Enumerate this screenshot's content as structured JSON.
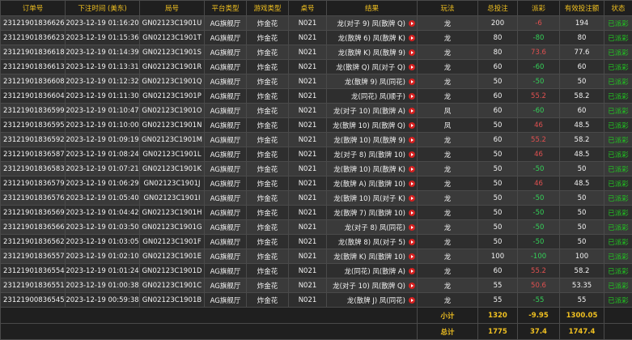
{
  "headers": [
    "订单号",
    "下注时间 (美东)",
    "局号",
    "平台类型",
    "游戏类型",
    "桌号",
    "结果",
    "玩法",
    "总投注",
    "派彩",
    "有效投注额",
    "状态"
  ],
  "rows": [
    {
      "id": "231219018366262",
      "time": "2023-12-19 01:16:20",
      "round": "GN02123C1901U",
      "platform": "AG旗舰厅",
      "game": "炸金花",
      "table": "N021",
      "result": "龙(对子 9) 凤(散牌 Q)",
      "play": "龙",
      "bet": "200",
      "payout": "-6",
      "payout_sign": "neg",
      "valid": "194",
      "status": "已派彩"
    },
    {
      "id": "231219018366230",
      "time": "2023-12-19 01:15:36",
      "round": "GN02123C1901T",
      "platform": "AG旗舰厅",
      "game": "炸金花",
      "table": "N021",
      "result": "龙(散牌 6) 凤(散牌 K)",
      "play": "龙",
      "bet": "80",
      "payout": "-80",
      "payout_sign": "pos",
      "valid": "80",
      "status": "已派彩"
    },
    {
      "id": "231219018366189",
      "time": "2023-12-19 01:14:39",
      "round": "GN02123C1901S",
      "platform": "AG旗舰厅",
      "game": "炸金花",
      "table": "N021",
      "result": "龙(散牌 K) 凤(散牌 9)",
      "play": "龙",
      "bet": "80",
      "payout": "73.6",
      "payout_sign": "neg",
      "valid": "77.6",
      "status": "已派彩"
    },
    {
      "id": "231219018366130",
      "time": "2023-12-19 01:13:31",
      "round": "GN02123C1901R",
      "platform": "AG旗舰厅",
      "game": "炸金花",
      "table": "N021",
      "result": "龙(散牌 Q) 凤(对子 Q)",
      "play": "龙",
      "bet": "60",
      "payout": "-60",
      "payout_sign": "pos",
      "valid": "60",
      "status": "已派彩"
    },
    {
      "id": "231219018366083",
      "time": "2023-12-19 01:12:32",
      "round": "GN02123C1901Q",
      "platform": "AG旗舰厅",
      "game": "炸金花",
      "table": "N021",
      "result": "龙(散牌 9) 凤(同花)",
      "play": "龙",
      "bet": "50",
      "payout": "-50",
      "payout_sign": "pos",
      "valid": "50",
      "status": "已派彩"
    },
    {
      "id": "231219018366040",
      "time": "2023-12-19 01:11:30",
      "round": "GN02123C1901P",
      "platform": "AG旗舰厅",
      "game": "炸金花",
      "table": "N021",
      "result": "龙(同花) 凤(顺子)",
      "play": "龙",
      "bet": "60",
      "payout": "55.2",
      "payout_sign": "neg",
      "valid": "58.2",
      "status": "已派彩"
    },
    {
      "id": "231219018365997",
      "time": "2023-12-19 01:10:47",
      "round": "GN02123C1901O",
      "platform": "AG旗舰厅",
      "game": "炸金花",
      "table": "N021",
      "result": "龙(对子 10) 凤(散牌 A)",
      "play": "凤",
      "bet": "60",
      "payout": "-60",
      "payout_sign": "pos",
      "valid": "60",
      "status": "已派彩"
    },
    {
      "id": "231219018365959",
      "time": "2023-12-19 01:10:00",
      "round": "GN02123C1901N",
      "platform": "AG旗舰厅",
      "game": "炸金花",
      "table": "N021",
      "result": "龙(散牌 10) 凤(散牌 Q)",
      "play": "凤",
      "bet": "50",
      "payout": "46",
      "payout_sign": "neg",
      "valid": "48.5",
      "status": "已派彩"
    },
    {
      "id": "231219018365923",
      "time": "2023-12-19 01:09:19",
      "round": "GN02123C1901M",
      "platform": "AG旗舰厅",
      "game": "炸金花",
      "table": "N021",
      "result": "龙(散牌 10) 凤(散牌 9)",
      "play": "龙",
      "bet": "60",
      "payout": "55.2",
      "payout_sign": "neg",
      "valid": "58.2",
      "status": "已派彩"
    },
    {
      "id": "231219018365879",
      "time": "2023-12-19 01:08:24",
      "round": "GN02123C1901L",
      "platform": "AG旗舰厅",
      "game": "炸金花",
      "table": "N021",
      "result": "龙(对子 8) 凤(散牌 10)",
      "play": "龙",
      "bet": "50",
      "payout": "46",
      "payout_sign": "neg",
      "valid": "48.5",
      "status": "已派彩"
    },
    {
      "id": "231219018365830",
      "time": "2023-12-19 01:07:21",
      "round": "GN02123C1901K",
      "platform": "AG旗舰厅",
      "game": "炸金花",
      "table": "N021",
      "result": "龙(散牌 10) 凤(散牌 K)",
      "play": "龙",
      "bet": "50",
      "payout": "-50",
      "payout_sign": "pos",
      "valid": "50",
      "status": "已派彩"
    },
    {
      "id": "231219018365793",
      "time": "2023-12-19 01:06:29",
      "round": "GN02123C1901J",
      "platform": "AG旗舰厅",
      "game": "炸金花",
      "table": "N021",
      "result": "龙(散牌 A) 凤(散牌 10)",
      "play": "龙",
      "bet": "50",
      "payout": "46",
      "payout_sign": "neg",
      "valid": "48.5",
      "status": "已派彩"
    },
    {
      "id": "231219018365760",
      "time": "2023-12-19 01:05:40",
      "round": "GN02123C1901I",
      "platform": "AG旗舰厅",
      "game": "炸金花",
      "table": "N021",
      "result": "龙(散牌 10) 凤(对子 K)",
      "play": "龙",
      "bet": "50",
      "payout": "-50",
      "payout_sign": "pos",
      "valid": "50",
      "status": "已派彩"
    },
    {
      "id": "231219018365699",
      "time": "2023-12-19 01:04:42",
      "round": "GN02123C1901H",
      "platform": "AG旗舰厅",
      "game": "炸金花",
      "table": "N021",
      "result": "龙(散牌 7) 凤(散牌 10)",
      "play": "龙",
      "bet": "50",
      "payout": "-50",
      "payout_sign": "pos",
      "valid": "50",
      "status": "已派彩"
    },
    {
      "id": "231219018365662",
      "time": "2023-12-19 01:03:50",
      "round": "GN02123C1901G",
      "platform": "AG旗舰厅",
      "game": "炸金花",
      "table": "N021",
      "result": "龙(对子 8) 凤(同花)",
      "play": "龙",
      "bet": "50",
      "payout": "-50",
      "payout_sign": "pos",
      "valid": "50",
      "status": "已派彩"
    },
    {
      "id": "231219018365625",
      "time": "2023-12-19 01:03:05",
      "round": "GN02123C1901F",
      "platform": "AG旗舰厅",
      "game": "炸金花",
      "table": "N021",
      "result": "龙(散牌 8) 凤(对子 5)",
      "play": "龙",
      "bet": "50",
      "payout": "-50",
      "payout_sign": "pos",
      "valid": "50",
      "status": "已派彩"
    },
    {
      "id": "231219018365579",
      "time": "2023-12-19 01:02:10",
      "round": "GN02123C1901E",
      "platform": "AG旗舰厅",
      "game": "炸金花",
      "table": "N021",
      "result": "龙(散牌 K) 凤(散牌 10)",
      "play": "龙",
      "bet": "100",
      "payout": "-100",
      "payout_sign": "pos",
      "valid": "100",
      "status": "已派彩"
    },
    {
      "id": "231219018365540",
      "time": "2023-12-19 01:01:24",
      "round": "GN02123C1901D",
      "platform": "AG旗舰厅",
      "game": "炸金花",
      "table": "N021",
      "result": "龙(同花) 凤(散牌 A)",
      "play": "龙",
      "bet": "60",
      "payout": "55.2",
      "payout_sign": "neg",
      "valid": "58.2",
      "status": "已派彩"
    },
    {
      "id": "231219018365510",
      "time": "2023-12-19 01:00:38",
      "round": "GN02123C1901C",
      "platform": "AG旗舰厅",
      "game": "炸金花",
      "table": "N021",
      "result": "龙(对子 10) 凤(散牌 Q)",
      "play": "龙",
      "bet": "55",
      "payout": "50.6",
      "payout_sign": "neg",
      "valid": "53.35",
      "status": "已派彩"
    },
    {
      "id": "231219008365454",
      "time": "2023-12-19 00:59:38",
      "round": "GN02123C1901B",
      "platform": "AG旗舰厅",
      "game": "炸金花",
      "table": "N021",
      "result": "龙(散牌 J) 凤(同花)",
      "play": "龙",
      "bet": "55",
      "payout": "-55",
      "payout_sign": "pos",
      "valid": "55",
      "status": "已派彩"
    }
  ],
  "subtotal": {
    "label": "小计",
    "bet": "1320",
    "payout": "-9.95",
    "valid": "1300.05"
  },
  "total": {
    "label": "总计",
    "bet": "1775",
    "payout": "37.4",
    "valid": "1747.4"
  },
  "colors": {
    "header": "#f0c020",
    "status": "#21c721",
    "positive": "#34d058",
    "negative": "#e05050",
    "play_icon": "#d42020"
  },
  "icons": {
    "play": "play-circle-icon"
  }
}
